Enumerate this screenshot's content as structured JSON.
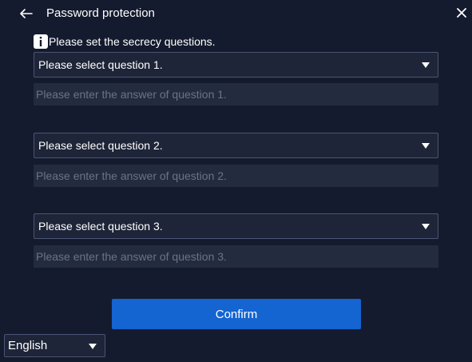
{
  "header": {
    "title": "Password protection",
    "back_icon": "arrow-left-icon",
    "close_icon": "close-icon"
  },
  "hint": {
    "icon": "info-icon",
    "text": "Please set the secrecy questions."
  },
  "questions": [
    {
      "select_label": "Please select question 1.",
      "answer_placeholder": "Please enter the answer of question 1.",
      "answer_value": ""
    },
    {
      "select_label": "Please select question 2.",
      "answer_placeholder": "Please enter the answer of question 2.",
      "answer_value": ""
    },
    {
      "select_label": "Please select question 3.",
      "answer_placeholder": "Please enter the answer of question 3.",
      "answer_value": ""
    }
  ],
  "confirm_label": "Confirm",
  "language": {
    "selected": "English"
  },
  "colors": {
    "background": "#151b2e",
    "accent": "#1464d2",
    "field_background": "#1e2538",
    "field_border": "#4a5475"
  }
}
